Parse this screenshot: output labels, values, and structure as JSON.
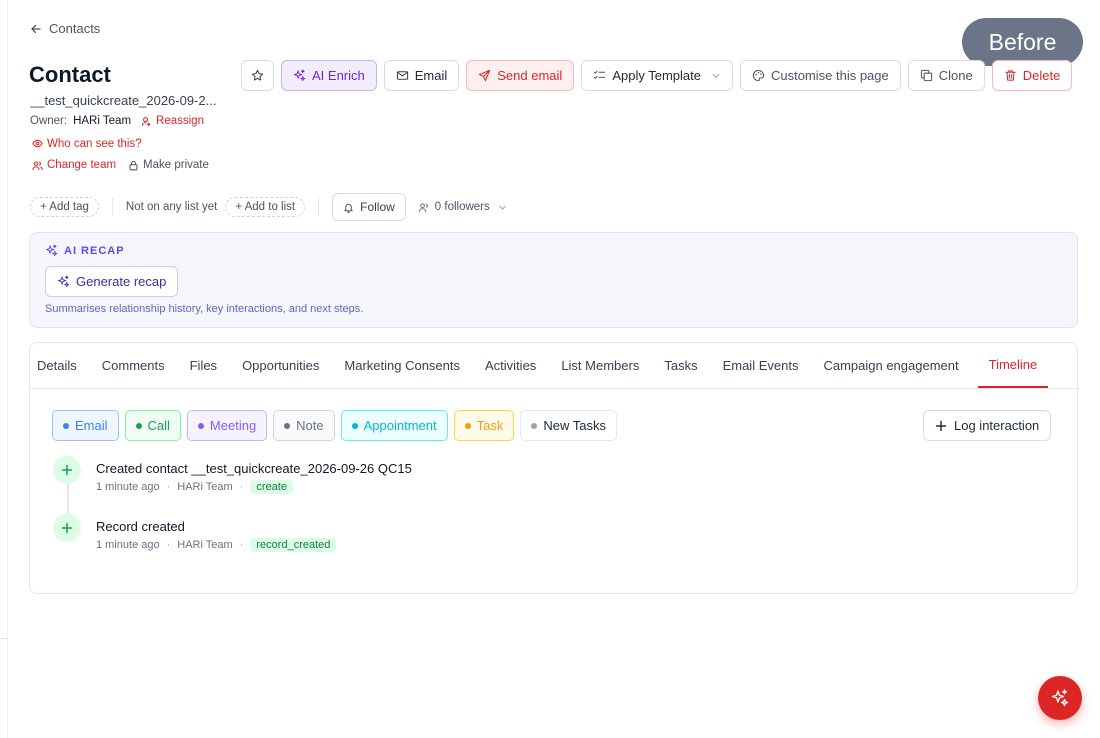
{
  "nav": {
    "back_label": "Contacts"
  },
  "overlay": {
    "before_label": "Before"
  },
  "header": {
    "title": "Contact",
    "subtitle": "__test_quickcreate_2026-09-2...",
    "owner_label": "Owner:",
    "owner_value": "HARi Team",
    "reassign_label": "Reassign",
    "visibility_label": "Who can see this?",
    "change_team_label": "Change team",
    "make_private_label": "Make private"
  },
  "actions": {
    "ai_enrich": "AI Enrich",
    "email": "Email",
    "send_email": "Send email",
    "apply_template": "Apply Template",
    "customise": "Customise this page",
    "clone": "Clone",
    "delete": "Delete"
  },
  "tags": {
    "add_tag": "+ Add tag",
    "list_status": "Not on any list yet",
    "add_to_list": "+ Add to list",
    "follow": "Follow",
    "followers": "0 followers"
  },
  "recap": {
    "heading": "AI RECAP",
    "button": "Generate recap",
    "description": "Summarises relationship history, key interactions, and next steps."
  },
  "tabs": [
    {
      "label": "Details"
    },
    {
      "label": "Comments"
    },
    {
      "label": "Files"
    },
    {
      "label": "Opportunities"
    },
    {
      "label": "Marketing Consents"
    },
    {
      "label": "Activities"
    },
    {
      "label": "List Members"
    },
    {
      "label": "Tasks"
    },
    {
      "label": "Email Events"
    },
    {
      "label": "Campaign engagement"
    },
    {
      "label": "Timeline"
    }
  ],
  "filters": [
    {
      "label": "Email",
      "color": "#3b82f6",
      "bg": "#eff6ff",
      "border": "#93c5fd"
    },
    {
      "label": "Call",
      "color": "#16a34a",
      "bg": "#f0fdf4",
      "border": "#86efac"
    },
    {
      "label": "Meeting",
      "color": "#8b5cf6",
      "bg": "#f5f3ff",
      "border": "#c4b5fd"
    },
    {
      "label": "Note",
      "color": "#6b7280",
      "bg": "#f9fafb",
      "border": "#d1d5db"
    },
    {
      "label": "Appointment",
      "color": "#06b6d4",
      "bg": "#ecfeff",
      "border": "#67e8f9"
    },
    {
      "label": "Task",
      "color": "#f59e0b",
      "bg": "#fffbeb",
      "border": "#fcd34d"
    },
    {
      "label": "New Tasks",
      "color": "#9ca3af",
      "bg": "#ffffff",
      "border": "#e5e7eb"
    }
  ],
  "log_interaction": "Log interaction",
  "timeline": [
    {
      "title": "Created contact __test_quickcreate_2026-09-26 QC15",
      "time": "1 minute ago",
      "actor": "HARi Team",
      "badge": "create"
    },
    {
      "title": "Record created",
      "time": "1 minute ago",
      "actor": "HARi Team",
      "badge": "record_created"
    }
  ],
  "colors": {
    "accent": "#dc2626",
    "ai": "#6d28d9"
  }
}
